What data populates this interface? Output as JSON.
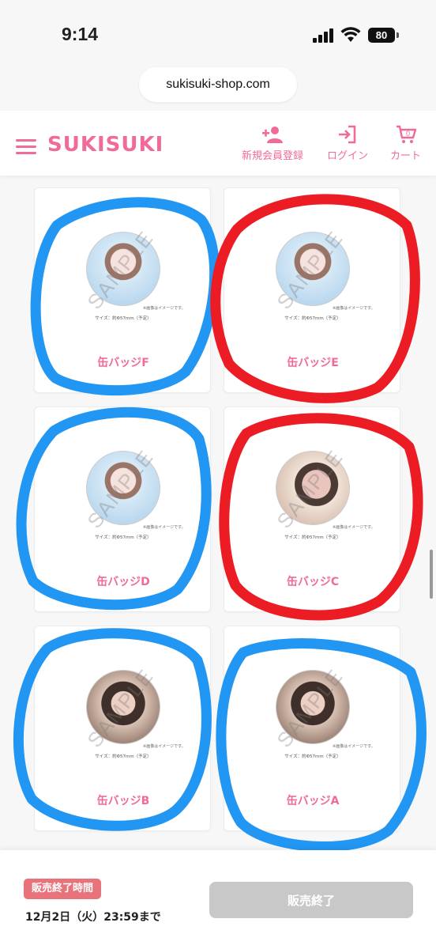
{
  "status_bar": {
    "time": "9:14",
    "battery": "80"
  },
  "browser": {
    "url": "sukisuki-shop.com"
  },
  "header": {
    "logo": "SUKISUKI",
    "nav": [
      {
        "icon": "add-user-icon",
        "label": "新規会員登録"
      },
      {
        "icon": "login-icon",
        "label": "ログイン"
      },
      {
        "icon": "cart-icon",
        "label": "カート",
        "count": "0"
      }
    ]
  },
  "products": [
    {
      "title": "缶バッジF",
      "watermark": "SAMPLE",
      "note": "※画像はイメージです。",
      "size": "サイズ：約Φ57mm（予定）"
    },
    {
      "title": "缶バッジE",
      "watermark": "SAMPLE",
      "note": "※画像はイメージです。",
      "size": "サイズ：約Φ57mm（予定）"
    },
    {
      "title": "缶バッジD",
      "watermark": "SAMPLE",
      "note": "※画像はイメージです。",
      "size": "サイズ：約Φ57mm（予定）"
    },
    {
      "title": "缶バッジC",
      "watermark": "SAMPLE",
      "note": "※画像はイメージです。",
      "size": "サイズ：約Φ57mm（予定）"
    },
    {
      "title": "缶バッジB",
      "watermark": "SAMPLE",
      "note": "※画像はイメージです。",
      "size": "サイズ：約Φ57mm（予定）"
    },
    {
      "title": "缶バッジA",
      "watermark": "SAMPLE",
      "note": "※画像はイメージです。",
      "size": "サイズ：約Φ57mm（予定）"
    }
  ],
  "footer": {
    "end_label": "販売終了時間",
    "end_time": "12月2日（火）23:59まで",
    "button_label": "販売終了"
  },
  "colors": {
    "brand_pink": "#f06b9a",
    "annotation_blue": "#2196f3",
    "annotation_red": "#ec1c24",
    "disabled_button": "#c8c8c8"
  }
}
